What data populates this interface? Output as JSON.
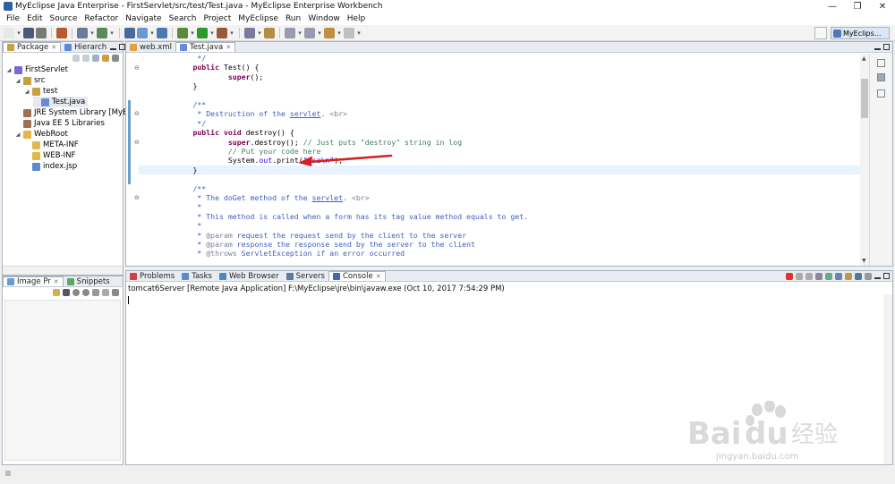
{
  "window": {
    "title": "MyEclipse Java Enterprise - FirstServlet/src/test/Test.java - MyEclipse Enterprise Workbench",
    "minimize": "—",
    "maximize": "❐",
    "close": "✕"
  },
  "menu": [
    "File",
    "Edit",
    "Source",
    "Refactor",
    "Navigate",
    "Search",
    "Project",
    "MyEclipse",
    "Run",
    "Window",
    "Help"
  ],
  "toolbar": {
    "perspective_label": "MyEclips..."
  },
  "package_panel": {
    "tabs": [
      {
        "label": "Package",
        "active": true
      },
      {
        "label": "Hierarch",
        "active": false
      }
    ],
    "tree": [
      {
        "label": "FirstServlet",
        "depth": 0,
        "icon": "project-icon"
      },
      {
        "label": "src",
        "depth": 1,
        "icon": "source-folder-icon"
      },
      {
        "label": "test",
        "depth": 2,
        "icon": "package-icon"
      },
      {
        "label": "Test.java",
        "depth": 3,
        "icon": "java-file-icon",
        "selected": true
      },
      {
        "label": "JRE System Library [MyEcli",
        "depth": 1,
        "icon": "library-icon"
      },
      {
        "label": "Java EE 5 Libraries",
        "depth": 1,
        "icon": "library-icon"
      },
      {
        "label": "WebRoot",
        "depth": 1,
        "icon": "folder-icon"
      },
      {
        "label": "META-INF",
        "depth": 2,
        "icon": "folder-icon"
      },
      {
        "label": "WEB-INF",
        "depth": 2,
        "icon": "folder-icon"
      },
      {
        "label": "index.jsp",
        "depth": 2,
        "icon": "jsp-file-icon"
      }
    ]
  },
  "image_panel": {
    "tabs": [
      {
        "label": "Image Pr",
        "active": true
      },
      {
        "label": "Snippets",
        "active": false
      }
    ]
  },
  "editor": {
    "tabs": [
      {
        "label": "web.xml",
        "active": false
      },
      {
        "label": "Test.java",
        "active": true
      }
    ],
    "lines": [
      {
        "parts": [
          {
            "t": "\t */",
            "c": "cm"
          }
        ]
      },
      {
        "parts": [
          {
            "t": "\t",
            "c": ""
          },
          {
            "t": "public",
            "c": "kw"
          },
          {
            "t": " Test() {",
            "c": ""
          }
        ]
      },
      {
        "parts": [
          {
            "t": "\t\t",
            "c": ""
          },
          {
            "t": "super",
            "c": "kw"
          },
          {
            "t": "();",
            "c": ""
          }
        ]
      },
      {
        "parts": [
          {
            "t": "\t}",
            "c": ""
          }
        ]
      },
      {
        "parts": [
          {
            "t": "",
            "c": ""
          }
        ]
      },
      {
        "parts": [
          {
            "t": "\t/**",
            "c": "cm"
          }
        ]
      },
      {
        "parts": [
          {
            "t": "\t * Destruction of the ",
            "c": "cm"
          },
          {
            "t": "servlet",
            "c": "cm ul"
          },
          {
            "t": ". ",
            "c": "cm"
          },
          {
            "t": "<br>",
            "c": "tg"
          }
        ]
      },
      {
        "parts": [
          {
            "t": "\t */",
            "c": "cm"
          }
        ]
      },
      {
        "parts": [
          {
            "t": "\t",
            "c": ""
          },
          {
            "t": "public void",
            "c": "kw"
          },
          {
            "t": " destroy() {",
            "c": ""
          }
        ]
      },
      {
        "parts": [
          {
            "t": "\t\t",
            "c": ""
          },
          {
            "t": "super",
            "c": "kw"
          },
          {
            "t": ".destroy(); ",
            "c": ""
          },
          {
            "t": "// Just puts \"destroy\" string in log",
            "c": "lc"
          }
        ]
      },
      {
        "parts": [
          {
            "t": "\t\t",
            "c": ""
          },
          {
            "t": "// Put your code here",
            "c": "lc"
          }
        ]
      },
      {
        "parts": [
          {
            "t": "\t\tSystem.",
            "c": ""
          },
          {
            "t": "out",
            "c": "st"
          },
          {
            "t": ".print(",
            "c": ""
          },
          {
            "t": "\"asa\\n\"",
            "c": "st"
          },
          {
            "t": ");",
            "c": ""
          }
        ]
      },
      {
        "parts": [
          {
            "t": "\t}",
            "c": ""
          }
        ],
        "highlight": true
      },
      {
        "parts": [
          {
            "t": "",
            "c": ""
          }
        ]
      },
      {
        "parts": [
          {
            "t": "\t/**",
            "c": "cm"
          }
        ]
      },
      {
        "parts": [
          {
            "t": "\t * The doGet method of the ",
            "c": "cm"
          },
          {
            "t": "servlet",
            "c": "cm ul"
          },
          {
            "t": ". ",
            "c": "cm"
          },
          {
            "t": "<br>",
            "c": "tg"
          }
        ]
      },
      {
        "parts": [
          {
            "t": "\t *",
            "c": "cm"
          }
        ]
      },
      {
        "parts": [
          {
            "t": "\t * This method is called when a form has its tag value method equals to get.",
            "c": "cm"
          }
        ]
      },
      {
        "parts": [
          {
            "t": "\t *",
            "c": "cm"
          }
        ]
      },
      {
        "parts": [
          {
            "t": "\t * ",
            "c": "cm"
          },
          {
            "t": "@param",
            "c": "tg"
          },
          {
            "t": " request the request send by the client to the server",
            "c": "cm"
          }
        ]
      },
      {
        "parts": [
          {
            "t": "\t * ",
            "c": "cm"
          },
          {
            "t": "@param",
            "c": "tg"
          },
          {
            "t": " response the response send by the server to the client",
            "c": "cm"
          }
        ]
      },
      {
        "parts": [
          {
            "t": "\t * ",
            "c": "cm"
          },
          {
            "t": "@throws",
            "c": "tg"
          },
          {
            "t": " ServletException if an error occurred",
            "c": "cm"
          }
        ]
      }
    ]
  },
  "console_panel": {
    "tabs": [
      {
        "label": "Problems",
        "active": false
      },
      {
        "label": "Tasks",
        "active": false
      },
      {
        "label": "Web Browser",
        "active": false
      },
      {
        "label": "Servers",
        "active": false
      },
      {
        "label": "Console",
        "active": true
      }
    ],
    "process_line": "tomcat6Server [Remote Java Application] F:\\MyEclipse\\jre\\bin\\javaw.exe (Oct 10, 2017 7:54:29 PM)"
  },
  "watermark": {
    "brand": "Bai",
    "brand2": "du",
    "cn": "经验",
    "url": "jingyan.baidu.com"
  },
  "colors": {
    "annotation_arrow": "#d62020",
    "keyword": "#7f0055",
    "javadoc": "#3f5fbf",
    "line_comment": "#3f7f5f",
    "string": "#2a00ff"
  }
}
